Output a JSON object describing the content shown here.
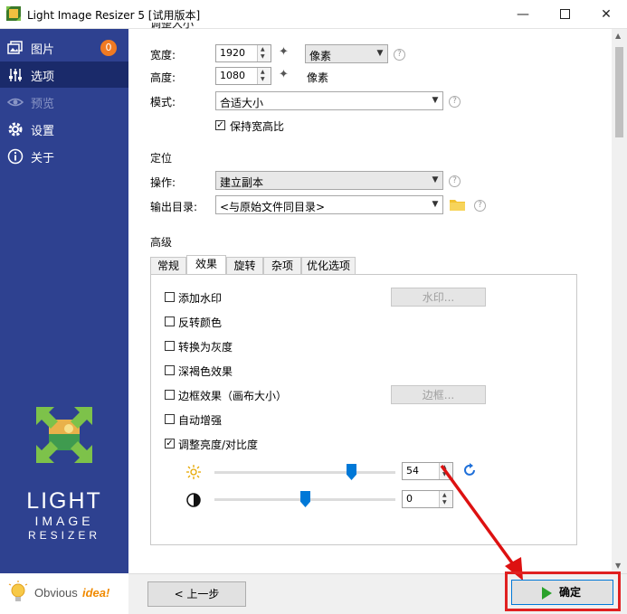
{
  "window": {
    "title": "Light Image Resizer 5  [试用版本]"
  },
  "sidebar": {
    "items": [
      {
        "label": "图片",
        "icon": "images-icon",
        "badge": "0"
      },
      {
        "label": "选项",
        "icon": "sliders-icon"
      },
      {
        "label": "预览",
        "icon": "eye-icon"
      },
      {
        "label": "设置",
        "icon": "gear-icon"
      },
      {
        "label": "关于",
        "icon": "info-icon"
      }
    ],
    "logo": {
      "line1": "LIGHT",
      "line2": "IMAGE",
      "line3": "RESIZER"
    },
    "brand": {
      "obvious": "Obvious",
      "idea": "idea!"
    }
  },
  "resize": {
    "section_title": "调整大小",
    "width_label": "宽度:",
    "width_value": "1920",
    "height_label": "高度:",
    "height_value": "1080",
    "unit_select": "像素",
    "unit_text": "像素",
    "mode_label": "模式:",
    "mode_value": "合适大小",
    "keep_ratio_label": "保持宽高比"
  },
  "target": {
    "section_title": "定位",
    "action_label": "操作:",
    "action_value": "建立副本",
    "output_label": "输出目录:",
    "output_value": "<与原始文件同目录>"
  },
  "advanced": {
    "section_title": "高级",
    "tabs": [
      "常规",
      "效果",
      "旋转",
      "杂项",
      "优化选项"
    ],
    "effects": [
      {
        "label": "添加水印",
        "checked": false
      },
      {
        "label": "反转颜色",
        "checked": false
      },
      {
        "label": "转换为灰度",
        "checked": false
      },
      {
        "label": "深褐色效果",
        "checked": false
      },
      {
        "label": "边框效果（画布大小）",
        "checked": false
      },
      {
        "label": "自动增强",
        "checked": false
      },
      {
        "label": "调整亮度/对比度",
        "checked": true
      }
    ],
    "watermark_button": "水印...",
    "border_button": "边框...",
    "brightness_value": "54",
    "brightness_level": 54,
    "contrast_value": "0",
    "contrast_level": 0
  },
  "footer": {
    "back_label": "< 上一步",
    "ok_label": "确定"
  },
  "colors": {
    "sidebar": "#2e4190",
    "sidebar_active": "#1a2a6a",
    "accent": "#0078d7",
    "badge": "#f07a22",
    "highlight": "#e02020"
  }
}
